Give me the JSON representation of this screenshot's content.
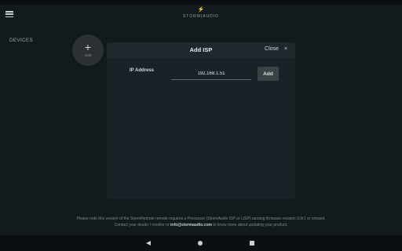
{
  "logo": {
    "bolt": "⚡",
    "text": "STORM|AUDIO"
  },
  "sidebar": {
    "devices_label": "DEVICES"
  },
  "add_device": {
    "plus": "+",
    "label": "ADD"
  },
  "modal": {
    "title": "Add ISP",
    "close_label": "Close",
    "close_icon": "×",
    "ip_label": "IP Address",
    "ip_value": "192.168.1.51",
    "add_button": "Add"
  },
  "notice": {
    "line1": "Please note this version of the StormRemote remote requires a Processor (StormAudio ISP or LISP) running firmware revision 3.9r1 or onward.",
    "line2_pre": "Contact your dealer / reseller or ",
    "line2_email": "info@stormaudio.com",
    "line2_post": " to know more about updating your product."
  },
  "nav": {
    "back": "back",
    "home": "home",
    "recent": "recent"
  }
}
